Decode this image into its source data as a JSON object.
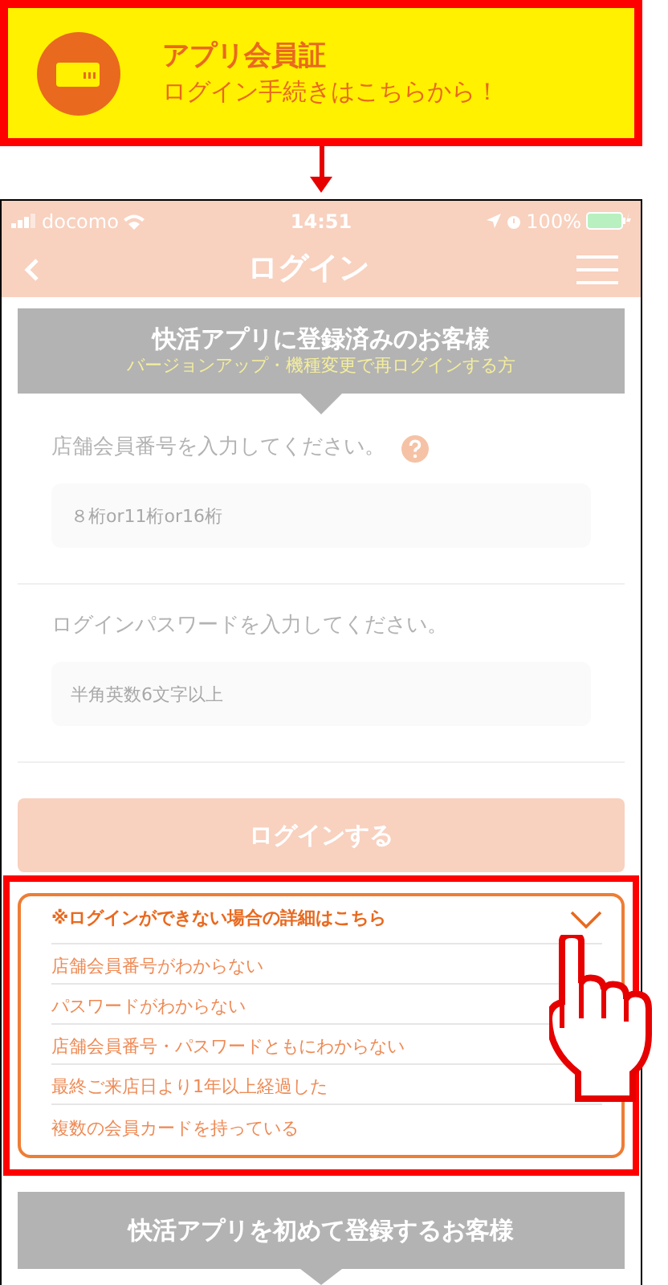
{
  "banner": {
    "title": "アプリ会員証",
    "subtitle": "ログイン手続きはこちらから！"
  },
  "status_bar": {
    "carrier": "docomo",
    "time": "14:51",
    "battery": "100%"
  },
  "nav": {
    "title": "ログイン"
  },
  "registered_section": {
    "title": "快活アプリに登録済みのお客様",
    "subtitle": "バージョンアップ・機種変更で再ログインする方",
    "fields": [
      {
        "label": "店舗会員番号を入力してください。",
        "placeholder": "８桁or11桁or16桁",
        "help": true
      },
      {
        "label": "ログインパスワードを入力してください。",
        "placeholder": "半角英数6文字以上",
        "help": false
      }
    ],
    "login_button": "ログインする"
  },
  "help_box": {
    "title": "※ログインができない場合の詳細はこちら",
    "expanded": true,
    "items": [
      "店舗会員番号がわからない",
      "パスワードがわからない",
      "店舗会員番号・パスワードともにわからない",
      "最終ご来店日より1年以上経過した",
      "複数の会員カードを持っている"
    ]
  },
  "new_section": {
    "title": "快活アプリを初めて登録するお客様"
  }
}
